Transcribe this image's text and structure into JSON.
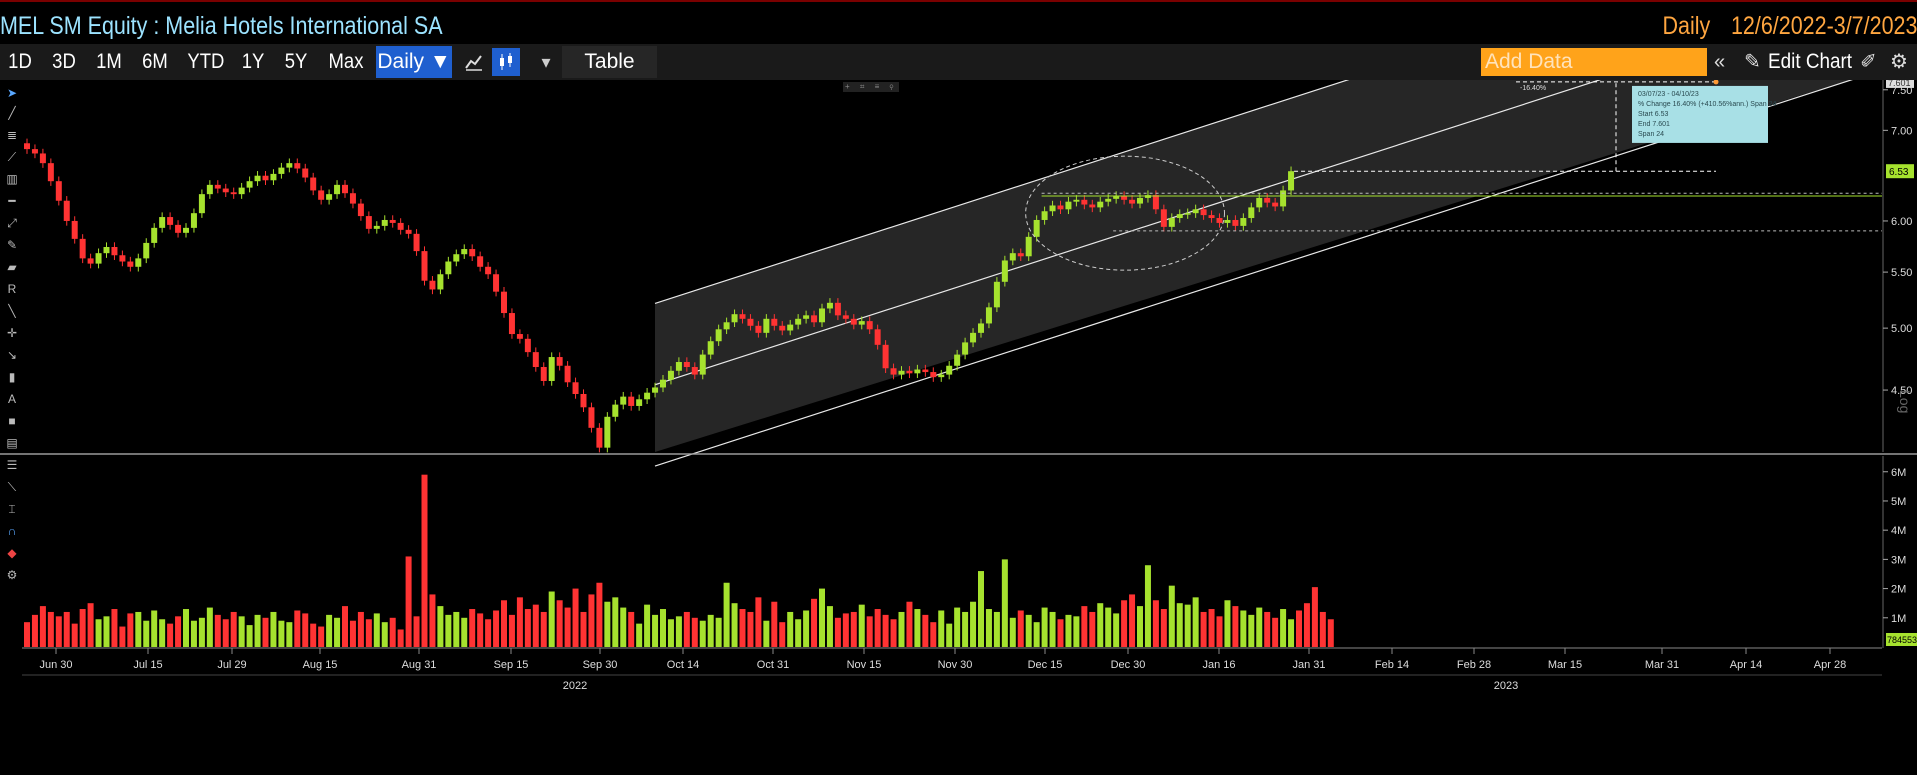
{
  "header": {
    "title": "MEL SM Equity : Melia Hotels International SA",
    "frequency": "Daily",
    "date_range": "12/6/2022-3/7/2023"
  },
  "toolbar": {
    "periods": [
      "1D",
      "3D",
      "1M",
      "6M",
      "YTD",
      "1Y",
      "5Y",
      "Max"
    ],
    "daily_label": "Daily ▼",
    "table_label": "Table",
    "add_data_placeholder": "Add Data",
    "edit_chart_label": "Edit Chart",
    "icons": [
      "line-chart-icon",
      "candle-chart-icon",
      "dropdown-icon",
      "collapse-icon",
      "pencil-icon",
      "edit-icon",
      "gear-icon"
    ]
  },
  "annotation": {
    "lines": [
      "03/07/23 - 04/10/23",
      "% Change  16.40% (+410.56%ann.) Span 24",
      "Start 6.53",
      "End   7.601",
      "Span 24"
    ],
    "target_label": "7.601",
    "change_label": "-16.40%"
  },
  "chart_data": [
    {
      "type": "candlestick",
      "title": "",
      "y_axis_scale": "log",
      "y_axis_label": "Log",
      "y_ticks": [
        4.5,
        5.0,
        5.5,
        6.0,
        7.0,
        7.5
      ],
      "ylim": [
        4.05,
        7.6
      ],
      "last_price": 6.53,
      "x_tick_labels": [
        "Jun 30",
        "Jul 15",
        "Jul 29",
        "Aug 15",
        "Aug 31",
        "Sep 15",
        "Sep 30",
        "Oct 14",
        "Oct 31",
        "Nov 15",
        "Nov 30",
        "Dec 15",
        "Dec 30",
        "Jan 16",
        "Jan 31",
        "Feb 14",
        "Feb 28",
        "Mar 15",
        "Mar 31",
        "Apr 14",
        "Apr 28"
      ],
      "year_labels": [
        "2022",
        "2023"
      ],
      "closes": [
        6.78,
        6.73,
        6.62,
        6.42,
        6.21,
        6.0,
        5.82,
        5.63,
        5.58,
        5.68,
        5.74,
        5.66,
        5.6,
        5.55,
        5.63,
        5.78,
        5.93,
        6.04,
        5.96,
        5.88,
        5.93,
        6.08,
        6.28,
        6.38,
        6.34,
        6.3,
        6.28,
        6.35,
        6.42,
        6.48,
        6.43,
        6.5,
        6.57,
        6.62,
        6.56,
        6.46,
        6.32,
        6.22,
        6.28,
        6.38,
        6.29,
        6.18,
        6.05,
        5.92,
        5.95,
        6.01,
        5.98,
        5.91,
        5.87,
        5.7,
        5.42,
        5.34,
        5.48,
        5.6,
        5.67,
        5.72,
        5.65,
        5.55,
        5.48,
        5.32,
        5.13,
        4.95,
        4.91,
        4.8,
        4.68,
        4.57,
        4.76,
        4.69,
        4.56,
        4.47,
        4.37,
        4.22,
        4.08,
        4.3,
        4.39,
        4.45,
        4.38,
        4.43,
        4.48,
        4.52,
        4.58,
        4.65,
        4.72,
        4.68,
        4.62,
        4.78,
        4.89,
        4.99,
        5.05,
        5.12,
        5.08,
        5.02,
        4.96,
        5.08,
        5.02,
        4.98,
        5.03,
        5.08,
        5.11,
        5.05,
        5.17,
        5.22,
        5.11,
        5.08,
        5.03,
        5.06,
        4.99,
        4.86,
        4.67,
        4.62,
        4.65,
        4.63,
        4.66,
        4.64,
        4.6,
        4.62,
        4.69,
        4.78,
        4.88,
        4.96,
        5.04,
        5.18,
        5.41,
        5.61,
        5.68,
        5.65,
        5.84,
        6.01,
        6.1,
        6.16,
        6.12,
        6.2,
        6.22,
        6.17,
        6.14,
        6.2,
        6.23,
        6.26,
        6.22,
        6.18,
        6.24,
        6.27,
        6.12,
        5.94,
        6.03,
        6.07,
        6.08,
        6.12,
        6.06,
        6.03,
        5.98,
        6.01,
        5.95,
        6.03,
        6.14,
        6.24,
        6.19,
        6.15,
        6.32,
        6.53
      ]
    },
    {
      "type": "bar",
      "title": "",
      "series_label": "Volume",
      "y_ticks": [
        "1M",
        "2M",
        "3M",
        "4M",
        "5M",
        "6M"
      ],
      "ylim": [
        0,
        6.3
      ],
      "last_volume_label": "784553",
      "values_millions": [
        0.85,
        1.1,
        1.4,
        1.2,
        1.05,
        1.2,
        0.8,
        1.3,
        1.5,
        0.95,
        1.05,
        1.3,
        0.7,
        1.15,
        1.2,
        0.9,
        1.25,
        0.95,
        0.8,
        1.05,
        1.3,
        0.9,
        1.0,
        1.35,
        1.1,
        0.95,
        1.2,
        1.05,
        0.75,
        1.1,
        1.0,
        1.2,
        0.9,
        0.85,
        1.25,
        1.15,
        0.8,
        0.7,
        1.1,
        1.0,
        1.4,
        0.9,
        1.2,
        0.95,
        1.15,
        0.85,
        1.0,
        0.6,
        3.1,
        1.05,
        5.9,
        1.8,
        1.4,
        1.1,
        1.2,
        1.0,
        1.3,
        1.15,
        0.95,
        1.25,
        1.6,
        1.1,
        1.7,
        1.3,
        1.45,
        1.2,
        1.9,
        1.6,
        1.35,
        2.0,
        1.2,
        1.8,
        2.2,
        1.55,
        1.7,
        1.35,
        1.2,
        0.8,
        1.45,
        1.1,
        1.3,
        0.95,
        1.05,
        1.2,
        1.0,
        0.9,
        1.1,
        1.0,
        2.2,
        1.5,
        1.3,
        1.2,
        1.7,
        0.9,
        1.55,
        0.85,
        1.2,
        0.95,
        1.25,
        1.65,
        2.0,
        1.4,
        1.0,
        1.15,
        1.2,
        1.45,
        1.05,
        1.3,
        1.1,
        0.95,
        1.2,
        1.55,
        1.3,
        1.1,
        0.85,
        1.25,
        0.8,
        1.35,
        1.2,
        1.55,
        2.6,
        1.3,
        1.2,
        3.0,
        1.0,
        1.25,
        1.1,
        0.85,
        1.35,
        1.2,
        0.95,
        1.1,
        1.05,
        1.4,
        1.2,
        1.5,
        1.35,
        1.15,
        1.6,
        1.8,
        1.4,
        2.8,
        1.6,
        1.3,
        2.1,
        1.5,
        1.45,
        1.7,
        1.2,
        1.3,
        1.05,
        1.6,
        1.4,
        1.25,
        1.1,
        1.35,
        1.2,
        1.0,
        1.3,
        0.95,
        1.25,
        1.5,
        2.05,
        1.2,
        0.95
      ]
    }
  ],
  "colors": {
    "up": "#a6e22e",
    "down": "#ff3333",
    "title": "#9ce3ff",
    "period": "#ffa640",
    "toolbar": "#1a1a1a",
    "active": "#1f5fcf",
    "channel_fill": "#262626",
    "annotation_bg": "#a8e0e6",
    "last_price_tag": "#a6e22e"
  }
}
